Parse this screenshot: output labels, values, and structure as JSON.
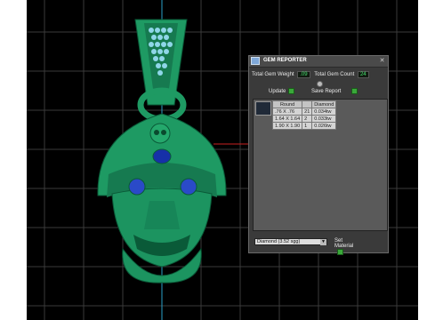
{
  "panel": {
    "title": "GEM REPORTER",
    "close_icon": "close-icon",
    "total_weight_label": "Total Gem Weight",
    "total_weight_value": ".09",
    "total_count_label": "Total Gem Count",
    "total_count_value": "24",
    "update_label": "Update",
    "save_report_label": "Save Report",
    "table": {
      "headers": [
        "Round",
        "",
        "Diamond"
      ],
      "rows": [
        [
          ".76 X .76",
          "21",
          "0.034tw"
        ],
        [
          "1.64 X 1.64",
          "2",
          "0.033tw"
        ],
        [
          "1.90 X 1.90",
          "1",
          "0.026tw"
        ]
      ]
    },
    "material_select": "Diamond    (3.52 sgg)",
    "set_material_label": "Set Material"
  },
  "colors": {
    "accent_green": "#2bd12b",
    "model_green": "#1e9a63",
    "grid": "#3a3a3a"
  }
}
